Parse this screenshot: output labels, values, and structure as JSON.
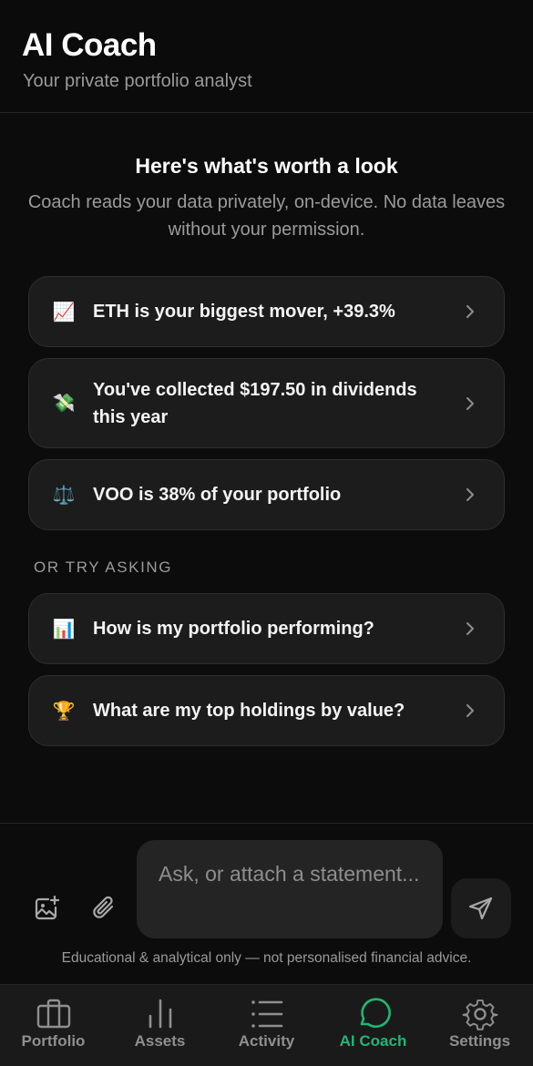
{
  "header": {
    "title": "AI Coach",
    "subtitle": "Your private portfolio analyst"
  },
  "intro": {
    "title": "Here's what's worth a look",
    "text": "Coach reads your data privately, on-device. No data leaves without your permission."
  },
  "insights": [
    {
      "emoji": "📈",
      "icon": "chart-increasing-icon",
      "label": "ETH is your biggest mover, +39.3%"
    },
    {
      "emoji": "💸",
      "icon": "money-with-wings-icon",
      "label": "You've collected $197.50 in dividends this year"
    },
    {
      "emoji": "⚖️",
      "icon": "balance-scale-icon",
      "label": "VOO is 38% of your portfolio"
    }
  ],
  "suggestions_label": "OR TRY ASKING",
  "suggestions": [
    {
      "emoji": "📊",
      "icon": "bar-chart-icon",
      "label": "How is my portfolio performing?"
    },
    {
      "emoji": "🏆",
      "icon": "trophy-icon",
      "label": "What are my top holdings by value?"
    }
  ],
  "composer": {
    "placeholder": "Ask, or attach a statement...",
    "disclaimer": "Educational & analytical only — not personalised financial advice."
  },
  "tabs": [
    {
      "label": "Portfolio",
      "icon": "briefcase-icon",
      "active": false
    },
    {
      "label": "Assets",
      "icon": "bar-chart-icon",
      "active": false
    },
    {
      "label": "Activity",
      "icon": "list-icon",
      "active": false
    },
    {
      "label": "AI Coach",
      "icon": "chat-bubble-icon",
      "active": true
    },
    {
      "label": "Settings",
      "icon": "gear-icon",
      "active": false
    }
  ],
  "colors": {
    "background": "#0c0c0c",
    "card": "#1c1c1c",
    "accent": "#22b574",
    "muted_text": "#9a9a9a"
  }
}
